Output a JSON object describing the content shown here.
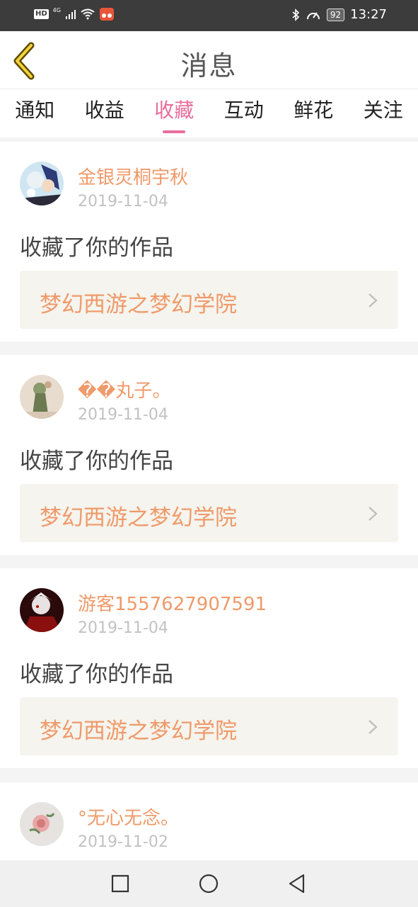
{
  "status_bar": {
    "hd": "HD",
    "network": "4G",
    "battery": "92",
    "time": "13:27"
  },
  "header": {
    "title": "消息"
  },
  "tabs": [
    {
      "label": "通知",
      "active": false
    },
    {
      "label": "收益",
      "active": false
    },
    {
      "label": "收藏",
      "active": true
    },
    {
      "label": "互动",
      "active": false
    },
    {
      "label": "鲜花",
      "active": false
    },
    {
      "label": "关注",
      "active": false
    }
  ],
  "messages": [
    {
      "user": "金银灵桐宇秋",
      "date": "2019-11-04",
      "action": "收藏了你的作品",
      "work": "梦幻西游之梦幻学院"
    },
    {
      "user": "��丸子。",
      "date": "2019-11-04",
      "action": "收藏了你的作品",
      "work": "梦幻西游之梦幻学院"
    },
    {
      "user": "游客1557627907591",
      "date": "2019-11-04",
      "action": "收藏了你的作品",
      "work": "梦幻西游之梦幻学院"
    },
    {
      "user": "°无心无念。",
      "date": "2019-11-02"
    }
  ],
  "colors": {
    "accent": "#e86d9c",
    "username": "#ef9a6a",
    "date": "#c2c2c2"
  }
}
